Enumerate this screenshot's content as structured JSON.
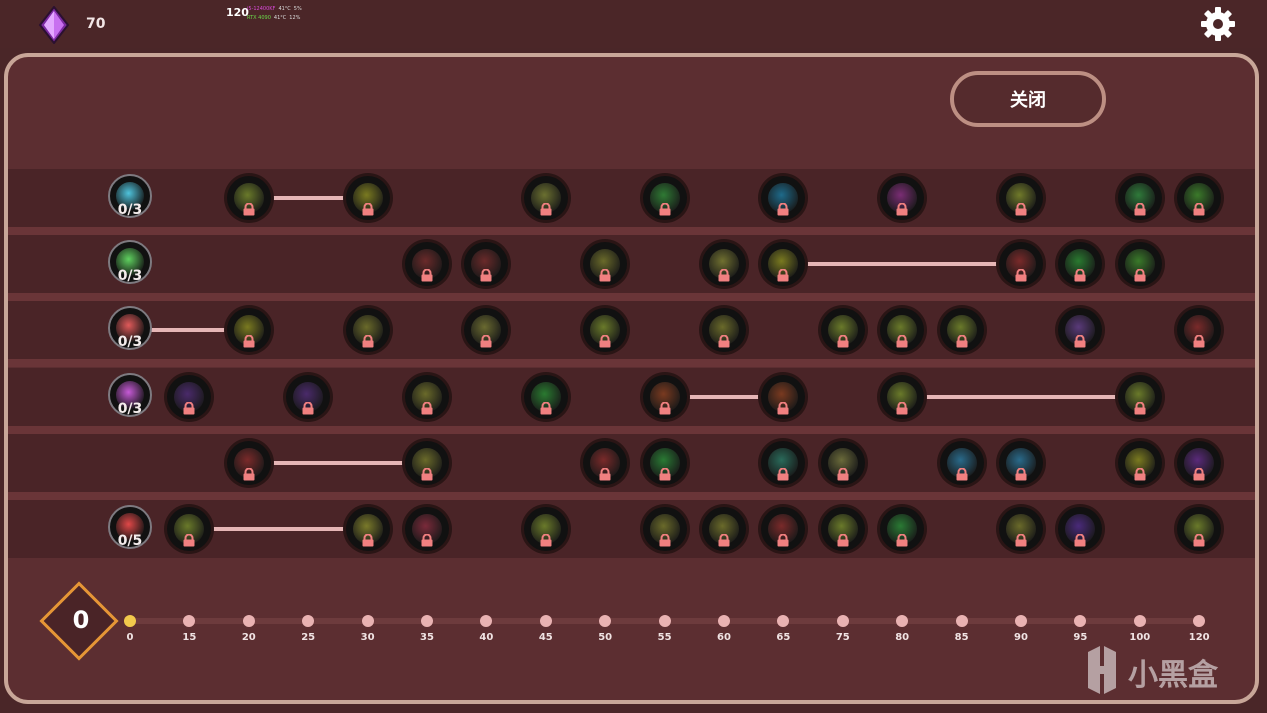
{
  "header": {
    "gem_count": "70",
    "settings_icon": "gear-icon",
    "fps": "120",
    "perf": {
      "cpu_label": "i5-12400KF",
      "cpu_temp": "41°C",
      "cpu_load": "5%",
      "gpu_label": "RTX 4090",
      "gpu_temp": "41°C",
      "gpu_load": "12%"
    }
  },
  "panel": {
    "close_label": "关闭"
  },
  "categories": [
    {
      "icon": "tornado-icon",
      "color": "#4fc3dc",
      "count": "0/3"
    },
    {
      "icon": "sword-icon",
      "color": "#5fd15f",
      "count": "0/3"
    },
    {
      "icon": "crossed-swords-icon",
      "color": "#e05a5a",
      "count": "0/3"
    },
    {
      "icon": "paw-icon",
      "color": "#c65ad6",
      "count": "0/3"
    },
    null,
    {
      "icon": "heart-icon",
      "color": "#e04848",
      "count": "0/5"
    }
  ],
  "nodes": [
    {
      "row": 0,
      "col": 2,
      "icon": "wood-log-icon",
      "color": "#6a7a2a"
    },
    {
      "row": 0,
      "col": 4,
      "icon": "flame-icon",
      "color": "#7a7a20"
    },
    {
      "row": 0,
      "col": 7,
      "icon": "fox-icon",
      "color": "#6b7030"
    },
    {
      "row": 0,
      "col": 9,
      "icon": "leaf-icon",
      "color": "#2f7a34"
    },
    {
      "row": 0,
      "col": 11,
      "icon": "water-drop-icon",
      "color": "#1e6a8a"
    },
    {
      "row": 0,
      "col": 13,
      "icon": "eye-icon",
      "color": "#7a2d74"
    },
    {
      "row": 0,
      "col": 15,
      "icon": "shield-icon",
      "color": "#707a2a"
    },
    {
      "row": 0,
      "col": 17,
      "icon": "flower-icon",
      "color": "#2f7a3a"
    },
    {
      "row": 0,
      "col": 18,
      "icon": "clover-icon",
      "color": "#3b7a2a"
    },
    {
      "row": 1,
      "col": 5,
      "icon": "skull-icon",
      "color": "#6a2a2a"
    },
    {
      "row": 1,
      "col": 6,
      "icon": "skull-bones-icon",
      "color": "#6a2a2a"
    },
    {
      "row": 1,
      "col": 8,
      "icon": "ghost-icon",
      "color": "#6a6a2a"
    },
    {
      "row": 1,
      "col": 10,
      "icon": "claw-icon",
      "color": "#707030"
    },
    {
      "row": 1,
      "col": 11,
      "icon": "lightning-icon",
      "color": "#7a7a20"
    },
    {
      "row": 1,
      "col": 15,
      "icon": "lava-icon",
      "color": "#7a2a2a"
    },
    {
      "row": 1,
      "col": 16,
      "icon": "poison-icon",
      "color": "#2a7a30"
    },
    {
      "row": 1,
      "col": 17,
      "icon": "percent-icon",
      "color": "#3a7a2a"
    },
    {
      "row": 2,
      "col": 2,
      "icon": "helmet-icon",
      "color": "#7a7a20"
    },
    {
      "row": 2,
      "col": 4,
      "icon": "fist-icon",
      "color": "#6a6a2a"
    },
    {
      "row": 2,
      "col": 6,
      "icon": "boot-icon",
      "color": "#6a6a30"
    },
    {
      "row": 2,
      "col": 8,
      "icon": "spiral-icon",
      "color": "#6a7a2a"
    },
    {
      "row": 2,
      "col": 10,
      "icon": "chest-icon",
      "color": "#6a6a2a"
    },
    {
      "row": 2,
      "col": 12,
      "icon": "sun-icon",
      "color": "#6a7a2a"
    },
    {
      "row": 2,
      "col": 13,
      "icon": "barrel-icon",
      "color": "#6a7a2a"
    },
    {
      "row": 2,
      "col": 14,
      "icon": "hammer-icon",
      "color": "#6a7a2a"
    },
    {
      "row": 2,
      "col": 16,
      "icon": "gear-spike-icon",
      "color": "#5a3a7a"
    },
    {
      "row": 2,
      "col": 18,
      "icon": "dragon-icon",
      "color": "#7a2a2a"
    },
    {
      "row": 3,
      "col": 1,
      "icon": "orb-icon",
      "color": "#4a2a6a"
    },
    {
      "row": 3,
      "col": 3,
      "icon": "moon-icon",
      "color": "#4a2a6a"
    },
    {
      "row": 3,
      "col": 5,
      "icon": "tree-icon",
      "color": "#6a6a2a"
    },
    {
      "row": 3,
      "col": 7,
      "icon": "bush-icon",
      "color": "#2a7a30"
    },
    {
      "row": 3,
      "col": 9,
      "icon": "fire-pit-icon",
      "color": "#7a3a20"
    },
    {
      "row": 3,
      "col": 11,
      "icon": "torch-icon",
      "color": "#7a3a20"
    },
    {
      "row": 3,
      "col": 13,
      "icon": "brick-wall-icon",
      "color": "#6a7a2a"
    },
    {
      "row": 3,
      "col": 17,
      "icon": "totem-icon",
      "color": "#6a7a2a"
    },
    {
      "row": 4,
      "col": 2,
      "icon": "claw-marks-icon",
      "color": "#7a2a2a"
    },
    {
      "row": 4,
      "col": 5,
      "icon": "saw-icon",
      "color": "#6a6a2a"
    },
    {
      "row": 4,
      "col": 8,
      "icon": "red-wings-icon",
      "color": "#7a2a2a"
    },
    {
      "row": 4,
      "col": 9,
      "icon": "green-claw-icon",
      "color": "#2a7a34"
    },
    {
      "row": 4,
      "col": 11,
      "icon": "serpent-icon",
      "color": "#2a6a5a"
    },
    {
      "row": 4,
      "col": 12,
      "icon": "bone-icon",
      "color": "#6a6a3a"
    },
    {
      "row": 4,
      "col": 14,
      "icon": "ice-crystal-icon",
      "color": "#2a6a8a"
    },
    {
      "row": 4,
      "col": 15,
      "icon": "ice-fang-icon",
      "color": "#2a6a8a"
    },
    {
      "row": 4,
      "col": 17,
      "icon": "golden-eye-icon",
      "color": "#7a7a20"
    },
    {
      "row": 4,
      "col": 18,
      "icon": "purple-eye-icon",
      "color": "#5a2a7a"
    },
    {
      "row": 5,
      "col": 1,
      "icon": "mushroom-icon",
      "color": "#6a7a2a"
    },
    {
      "row": 5,
      "col": 4,
      "icon": "axe-icon",
      "color": "#7a7a2a"
    },
    {
      "row": 5,
      "col": 5,
      "icon": "blade-icon",
      "color": "#7a2a3a"
    },
    {
      "row": 5,
      "col": 7,
      "icon": "mask-icon",
      "color": "#6a7a2a"
    },
    {
      "row": 5,
      "col": 9,
      "icon": "pillar-icon",
      "color": "#6a6a2a"
    },
    {
      "row": 5,
      "col": 10,
      "icon": "dagger-icon",
      "color": "#6a6a2a"
    },
    {
      "row": 5,
      "col": 11,
      "icon": "spikes-icon",
      "color": "#7a2a2a"
    },
    {
      "row": 5,
      "col": 12,
      "icon": "stone-wall-icon",
      "color": "#6a7a2a"
    },
    {
      "row": 5,
      "col": 13,
      "icon": "plant-icon",
      "color": "#2a7a34"
    },
    {
      "row": 5,
      "col": 15,
      "icon": "gauntlet-icon",
      "color": "#6a6a2a"
    },
    {
      "row": 5,
      "col": 16,
      "icon": "bottle-icon",
      "color": "#4a2a7a"
    },
    {
      "row": 5,
      "col": 18,
      "icon": "brain-icon",
      "color": "#6a7a2a"
    }
  ],
  "links": [
    {
      "row": 0,
      "from": 2,
      "to": 4
    },
    {
      "row": 1,
      "from": 11,
      "to": 15
    },
    {
      "row": 2,
      "from": 0,
      "to": 2
    },
    {
      "row": 3,
      "from": 9,
      "to": 11
    },
    {
      "row": 3,
      "from": 13,
      "to": 17
    },
    {
      "row": 4,
      "from": 2,
      "to": 5
    },
    {
      "row": 5,
      "from": 1,
      "to": 4
    }
  ],
  "level": {
    "current": "0",
    "ticks": [
      "0",
      "15",
      "20",
      "25",
      "30",
      "35",
      "40",
      "45",
      "50",
      "55",
      "60",
      "65",
      "75",
      "80",
      "85",
      "90",
      "95",
      "100",
      "120"
    ]
  },
  "watermark": {
    "text": "小黑盒",
    "icon": "heybox-logo-icon"
  },
  "colors": {
    "accent_orange": "#e69636",
    "link_pink": "#e6b6b6",
    "lock_pink": "#f08080",
    "active_dot": "#f2c94c"
  }
}
